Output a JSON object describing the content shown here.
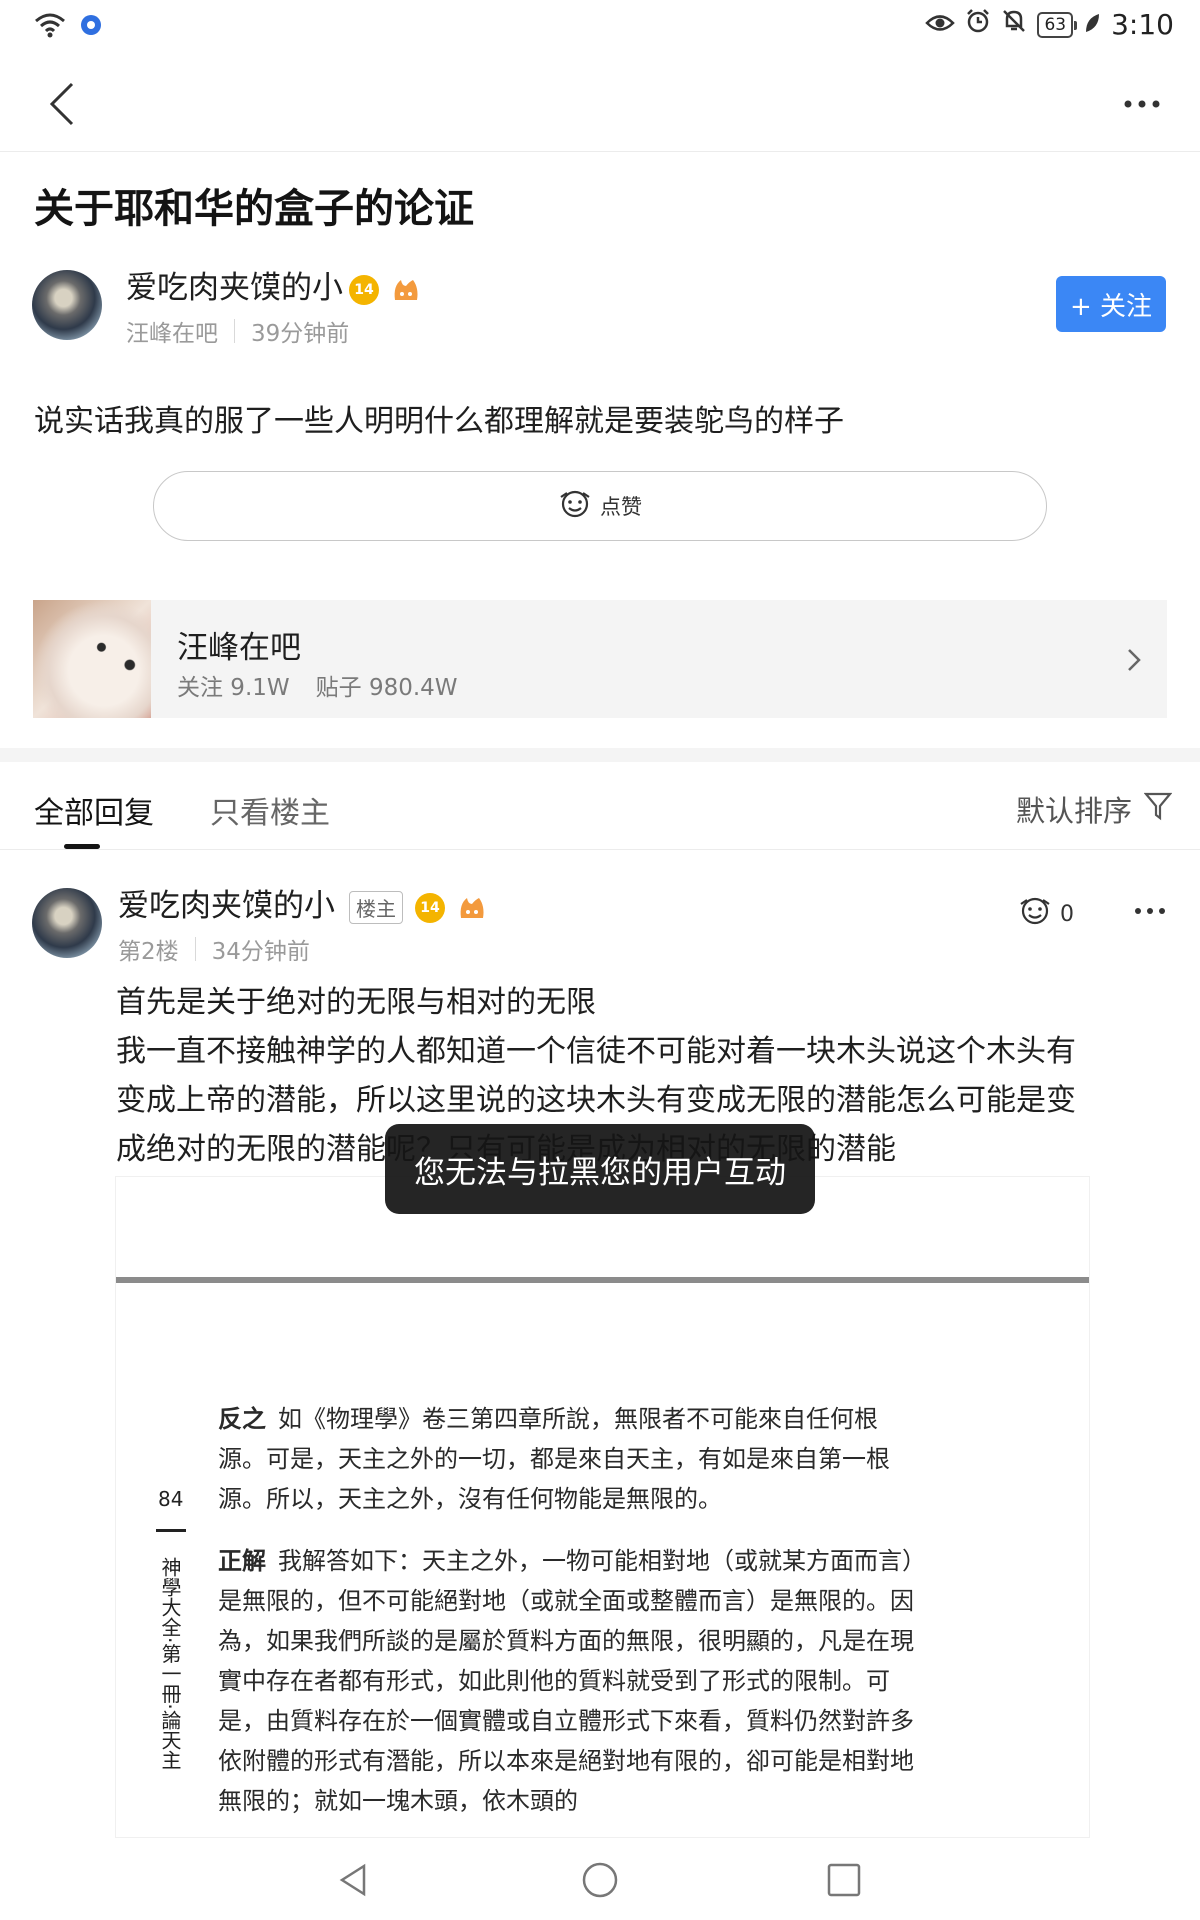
{
  "status_bar": {
    "battery": "63",
    "time": "3:10"
  },
  "post": {
    "title": "关于耶和华的盒子的论证",
    "author": {
      "name": "爱吃肉夹馍的小",
      "level": "14",
      "forum": "汪峰在吧",
      "time": "39分钟前"
    },
    "follow_label": "+ 关注",
    "body": "说实话我真的服了一些人明明什么都理解就是要装鸵鸟的样子",
    "like_label": "点赞"
  },
  "forum": {
    "name": "汪峰在吧",
    "followers": "关注 9.1W",
    "posts": "贴子 980.4W"
  },
  "tabs": {
    "all": "全部回复",
    "op_only": "只看楼主",
    "sort": "默认排序"
  },
  "reply": {
    "author": "爱吃肉夹馍的小",
    "tag": "楼主",
    "level": "14",
    "floor": "第2楼",
    "time": "34分钟前",
    "likes": "0",
    "lines": [
      "首先是关于绝对的无限与相对的无限",
      "我一直不接触神学的人都知道一个信徒不可能对着一块木头说这个木头有",
      "变成上帝的潜能，所以这里说的这块木头有变成无限的潜能怎么可能是变",
      "成绝对的无限的潜能呢？只有可能是成为相对的无限的潜能"
    ]
  },
  "scan": {
    "page_number": "84",
    "side_title": "神學大全·第一冊·論天主",
    "para1_label": "反之",
    "para1": "如《物理學》卷三第四章所說，無限者不可能來自任何根源。可是，天主之外的一切，都是來自天主，有如是來自第一根源。所以，天主之外，沒有任何物能是無限的。",
    "para2_label": "正解",
    "para2": "我解答如下：天主之外，一物可能相對地（或就某方面而言）是無限的，但不可能絕對地（或就全面或整體而言）是無限的。因為，如果我們所談的是屬於質料方面的無限，很明顯的，凡是在現實中存在者都有形式，如此則他的質料就受到了形式的限制。可是，由質料存在於一個實體或自立體形式下來看，質料仍然對許多依附體的形式有潛能，所以本來是絕對地有限的，卻可能是相對地無限的；就如一塊木頭，依木頭的"
  },
  "toast": "您无法与拉黑您的用户互动",
  "colors": {
    "accent": "#3b87f5",
    "level_badge": "#f4b400"
  }
}
